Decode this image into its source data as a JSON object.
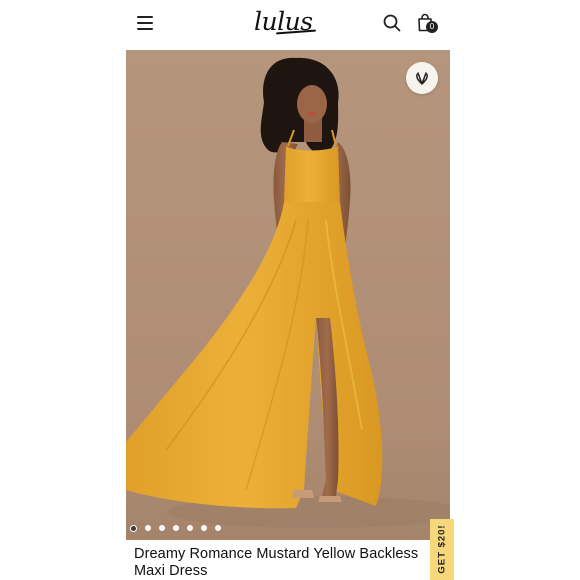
{
  "header": {
    "logo_text": "lulus",
    "bag_count": "0"
  },
  "product": {
    "title": "Dreamy Romance Mustard Yellow Backless Maxi Dress",
    "image_count": 7,
    "active_image_index": 0,
    "dress_color": "#e8a82e",
    "background_color": "#b08f76"
  },
  "promo": {
    "label": "GET $20!",
    "color": "#f6d87a"
  },
  "icons": {
    "menu": "hamburger-menu-icon",
    "search": "search-icon",
    "bag": "shopping-bag-icon",
    "wishlist": "heart-icon"
  }
}
